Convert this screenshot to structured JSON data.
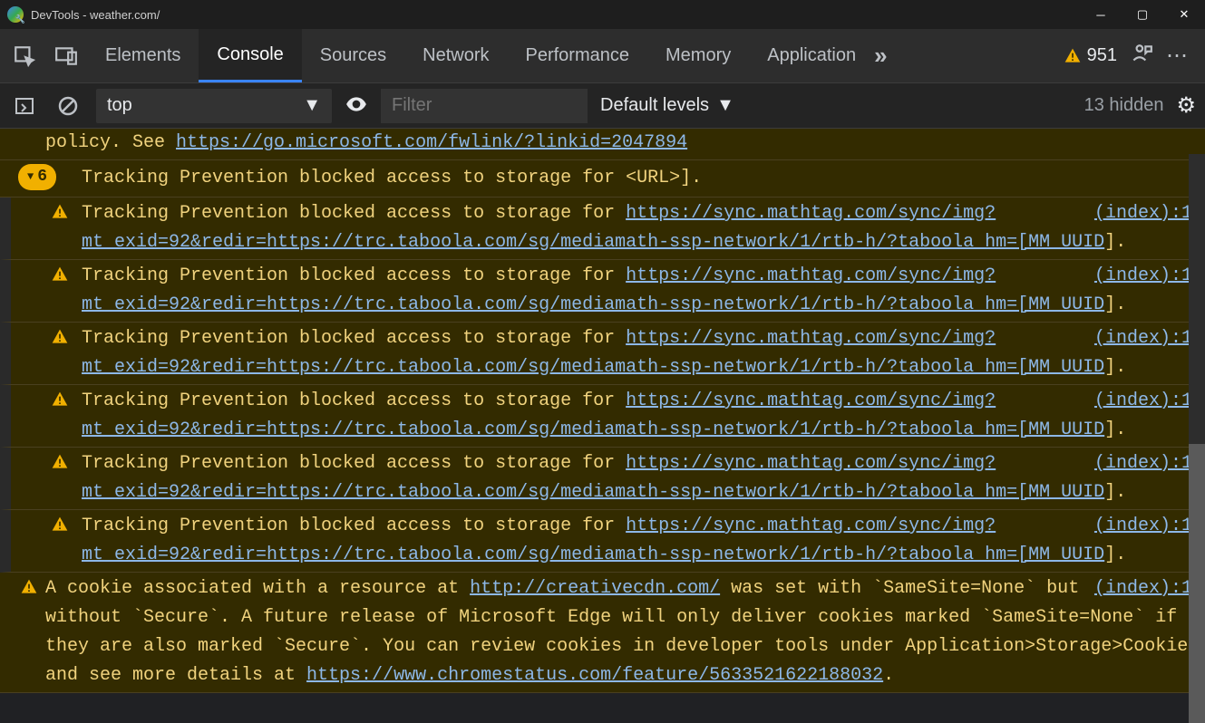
{
  "window": {
    "title": "DevTools - weather.com/"
  },
  "toolbar": {
    "tabs": [
      "Elements",
      "Console",
      "Sources",
      "Network",
      "Performance",
      "Memory",
      "Application"
    ],
    "active_tab": "Console",
    "warn_count": "951"
  },
  "filter_bar": {
    "context": "top",
    "filter_placeholder": "Filter",
    "levels": "Default levels",
    "hidden_text": "13 hidden"
  },
  "messages": {
    "top_fragment_text": "policy. See ",
    "top_fragment_link": "https://go.microsoft.com/fwlink/?linkid=2047894",
    "group_count": "6",
    "group_head": "Tracking Prevention blocked access to storage for <URL>].",
    "track_prefix": "Tracking Prevention blocked access to storage for ",
    "track_url": "https://sync.mathtag.com/sync/img?mt_exid=92&redir=https://trc.taboola.com/sg/mediamath-ssp-network/1/rtb-h/?taboola_hm=[MM_UUID",
    "track_suffix": "].",
    "track_src": "(index):1",
    "cookie_src": "(index):1",
    "cookie_t1": "A cookie associated with a resource at ",
    "cookie_l1": "http://creativecdn.com/",
    "cookie_t2": " was set with `SameSite=None` but without `Secure`. A future release of Microsoft Edge will only deliver cookies marked `SameSite=None` if they are also marked `Secure`. You can review cookies in developer tools under Application>Storage>Cookies and see more details at ",
    "cookie_l2": "https://www.chromestatus.com/feature/5633521622188032",
    "cookie_t3": "."
  }
}
